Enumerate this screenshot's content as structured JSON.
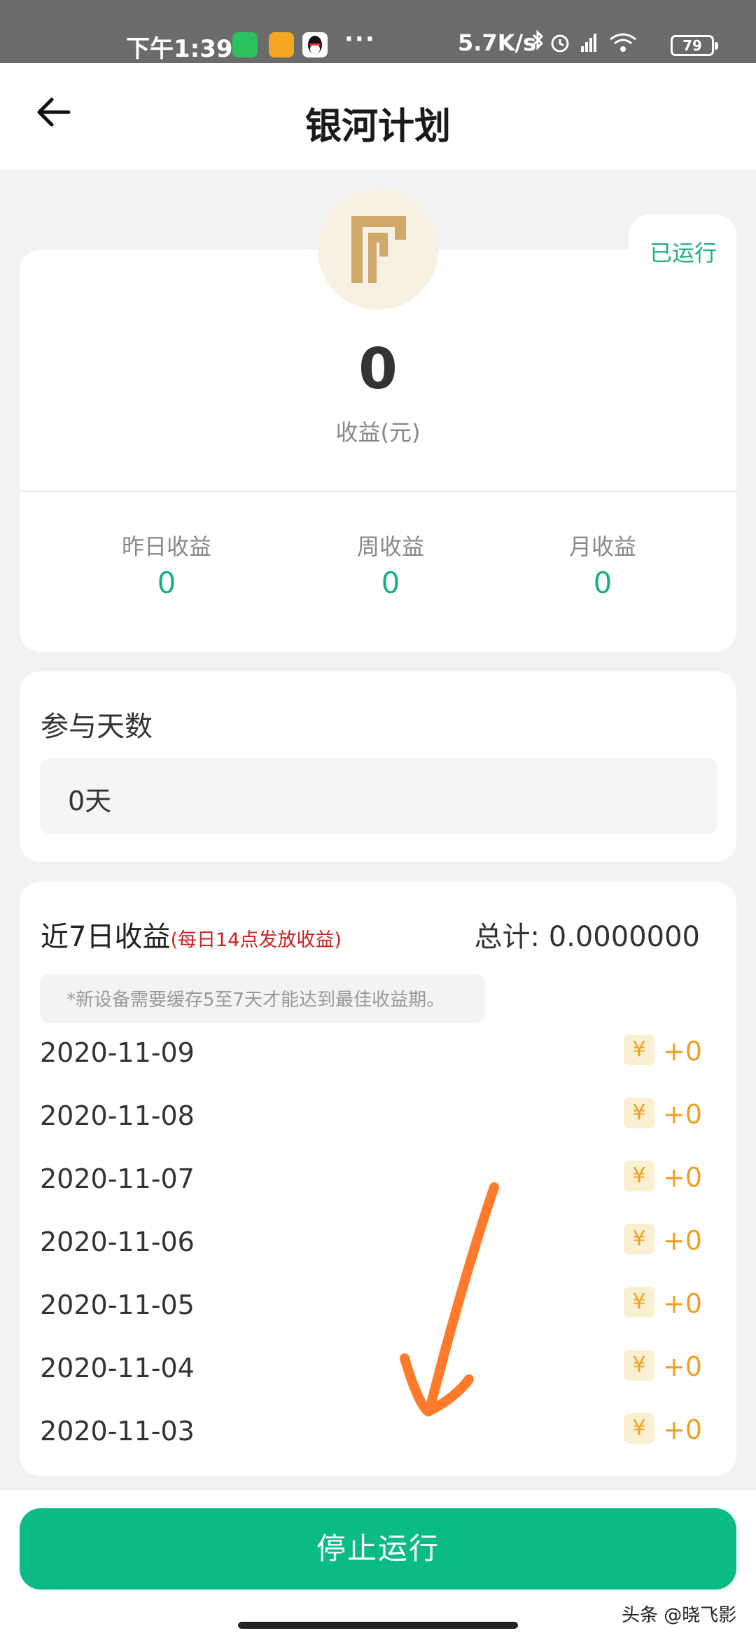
{
  "status_bar": {
    "time": "下午1:39",
    "dots": "···",
    "net_speed": "5.7K/s",
    "battery": "79"
  },
  "nav": {
    "title": "银河计划"
  },
  "summary": {
    "status": "已运行",
    "income_value": "0",
    "income_label": "收益(元)",
    "stats": [
      {
        "label": "昨日收益",
        "value": "0"
      },
      {
        "label": "周收益",
        "value": "0"
      },
      {
        "label": "月收益",
        "value": "0"
      }
    ]
  },
  "participation": {
    "title": "参与天数",
    "value": "0天"
  },
  "recent": {
    "title": "近7日收益",
    "note": "(每日14点发放收益)",
    "total": "总计: 0.0000000",
    "hint": "*新设备需要缓存5至7天才能达到最佳收益期。",
    "currency_symbol": "¥",
    "rows": [
      {
        "date": "2020-11-09",
        "amount": "+0"
      },
      {
        "date": "2020-11-08",
        "amount": "+0"
      },
      {
        "date": "2020-11-07",
        "amount": "+0"
      },
      {
        "date": "2020-11-06",
        "amount": "+0"
      },
      {
        "date": "2020-11-05",
        "amount": "+0"
      },
      {
        "date": "2020-11-04",
        "amount": "+0"
      },
      {
        "date": "2020-11-03",
        "amount": "+0"
      }
    ]
  },
  "footer": {
    "stop_label": "停止运行"
  },
  "watermark": "头条 @晓飞影",
  "colors": {
    "accent": "#0bbb85",
    "green_text": "#1fae82",
    "gold": "#f0a020",
    "note_red": "#d02020",
    "annotation_arrow": "#ff7a2a"
  }
}
